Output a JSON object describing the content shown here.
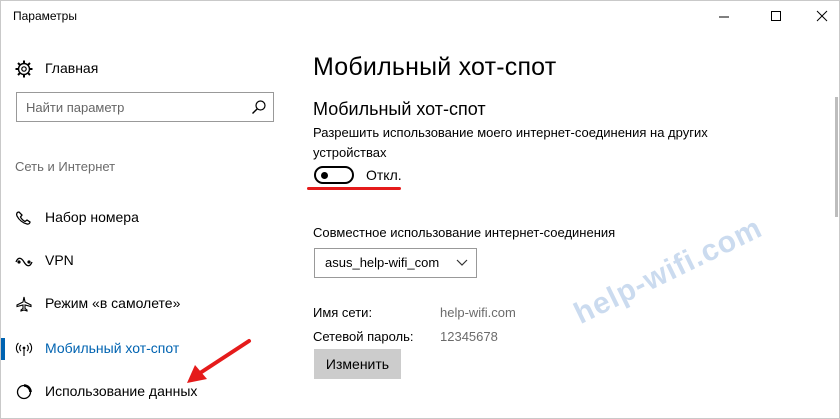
{
  "window": {
    "title": "Параметры"
  },
  "sidebar": {
    "home_label": "Главная",
    "search_placeholder": "Найти параметр",
    "section_header": "Сеть и Интернет",
    "items": [
      {
        "label": "Набор номера",
        "icon": "dialup-icon"
      },
      {
        "label": "VPN",
        "icon": "vpn-icon"
      },
      {
        "label": "Режим «в самолете»",
        "icon": "airplane-icon"
      },
      {
        "label": "Мобильный хот-спот",
        "icon": "hotspot-icon",
        "selected": true
      },
      {
        "label": "Использование данных",
        "icon": "data-usage-icon"
      }
    ]
  },
  "main": {
    "page_title": "Мобильный хот-спот",
    "section_title": "Мобильный хот-спот",
    "description": "Разрешить использование моего интернет-соединения на других устройствах",
    "toggle_state": "Откл.",
    "share_label": "Совместное использование интернет-соединения",
    "share_selected": "asus_help-wifi_com",
    "network_name_label": "Имя сети:",
    "network_name_value": "help-wifi.com",
    "password_label": "Сетевой пароль:",
    "password_value": "12345678",
    "change_button": "Изменить"
  },
  "watermark": {
    "text": "help-wifi.com"
  },
  "colors": {
    "accent": "#0063b1",
    "annotation_red": "#e51b1b",
    "button_gray": "#cccccc"
  }
}
